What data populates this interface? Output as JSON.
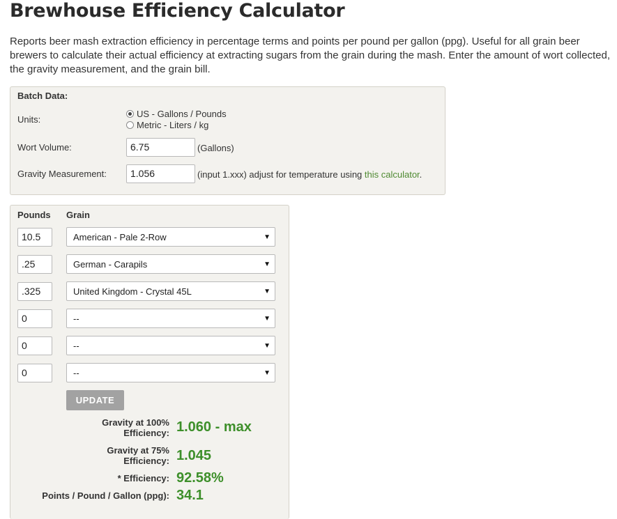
{
  "page": {
    "title": "Brewhouse Efficiency Calculator",
    "description": "Reports beer mash extraction efficiency in percentage terms and points per pound per gallon (ppg). Useful for all grain beer brewers to calculate their actual efficiency at extracting sugars from the grain during the mash. Enter the amount of wort collected, the gravity measurement, and the grain bill."
  },
  "batch": {
    "heading": "Batch Data:",
    "units_label": "Units:",
    "unit_options": [
      "US - Gallons / Pounds",
      "Metric - Liters / kg"
    ],
    "selected_unit": "US - Gallons / Pounds",
    "wort_volume_label": "Wort Volume:",
    "wort_volume_value": "6.75",
    "wort_volume_unit": "(Gallons)",
    "gravity_label": "Gravity Measurement:",
    "gravity_value": "1.056",
    "gravity_note": "(input 1.xxx) adjust for temperature using",
    "gravity_link": "this calculator",
    "gravity_note_end": "."
  },
  "grain": {
    "col_pounds": "Pounds",
    "col_grain": "Grain",
    "rows": [
      {
        "pounds": "10.5",
        "grain": "American - Pale 2-Row"
      },
      {
        "pounds": ".25",
        "grain": "German - Carapils"
      },
      {
        "pounds": ".325",
        "grain": "United Kingdom - Crystal 45L"
      },
      {
        "pounds": "0",
        "grain": "--"
      },
      {
        "pounds": "0",
        "grain": "--"
      },
      {
        "pounds": "0",
        "grain": "--"
      }
    ],
    "update_label": "UPDATE"
  },
  "results": {
    "grav100_label_1": "Gravity at 100%",
    "grav100_label_2": "Efficiency:",
    "grav100_value": "1.060 - max",
    "grav75_label_1": "Gravity at 75%",
    "grav75_label_2": "Efficiency:",
    "grav75_value": "1.045",
    "eff_label": "* Efficiency:",
    "eff_value": "92.58%",
    "ppg_label": "Points / Pound / Gallon (ppg):",
    "ppg_value": "34.1"
  },
  "icons": {
    "select_caret": "▼"
  },
  "colors": {
    "result_green": "#3d8f2a",
    "link_green": "#4f8a32",
    "button_gray": "#a2a2a2",
    "panel_bg": "#f3f2ee"
  }
}
